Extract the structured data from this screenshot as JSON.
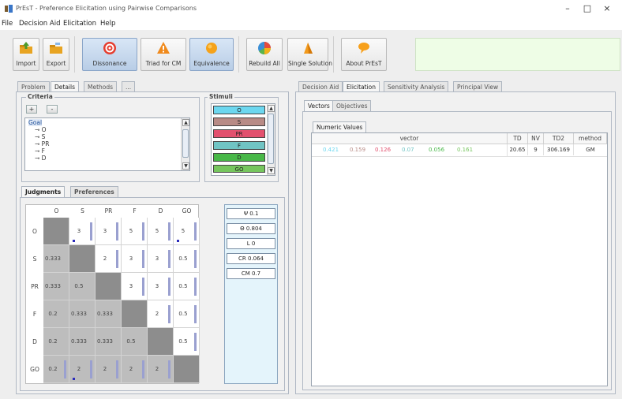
{
  "window": {
    "title": "PrEsT - Preference Elicitation using Pairwise Comparisons",
    "minimize": "–",
    "maximize": "□",
    "close": "×"
  },
  "menu": [
    "File",
    "Decision Aid",
    "Elicitation",
    "Help"
  ],
  "toolbar": {
    "buttons": [
      {
        "label": "Import",
        "icon": "folder-up-icon"
      },
      {
        "label": "Export",
        "icon": "folder-export-icon"
      },
      {
        "label": "Dissonance",
        "icon": "target-icon"
      },
      {
        "label": "Triad for CM",
        "icon": "warning-triangle-icon"
      },
      {
        "label": "Equivalence",
        "icon": "orange-circle-icon"
      },
      {
        "label": "Rebuild All",
        "icon": "pie-chart-icon"
      },
      {
        "label": "Single Solution",
        "icon": "cone-icon"
      },
      {
        "label": "About PrEsT",
        "icon": "speech-bubble-icon"
      }
    ]
  },
  "left_tabs": [
    "Problem",
    "Details",
    "Methods",
    "..."
  ],
  "criteria": {
    "title": "Criteria",
    "add": "+",
    "remove": "-",
    "tree": [
      "Goal",
      "O",
      "S",
      "PR",
      "F",
      "D"
    ]
  },
  "stimuli": {
    "title": "Stimuli",
    "items": [
      {
        "label": "O",
        "color": "#6cd7ef"
      },
      {
        "label": "S",
        "color": "#b88b86"
      },
      {
        "label": "PR",
        "color": "#e2506e"
      },
      {
        "label": "F",
        "color": "#70c4c4"
      },
      {
        "label": "D",
        "color": "#48b848"
      },
      {
        "label": "GO",
        "color": "#76c65e"
      }
    ]
  },
  "matrix_tabs": [
    "Judgments",
    "Preferences"
  ],
  "matrix": {
    "labels": [
      "O",
      "S",
      "PR",
      "F",
      "D",
      "GO"
    ],
    "rows": [
      [
        "",
        "3",
        "3",
        "5",
        "5",
        "5"
      ],
      [
        "0.333",
        "",
        "2",
        "3",
        "3",
        "0.5"
      ],
      [
        "0.333",
        "0.5",
        "",
        "3",
        "3",
        "0.5"
      ],
      [
        "0.2",
        "0.333",
        "0.333",
        "",
        "2",
        "0.5"
      ],
      [
        "0.2",
        "0.333",
        "0.333",
        "0.5",
        "",
        "0.5"
      ],
      [
        "0.2",
        "2",
        "2",
        "2",
        "2",
        ""
      ]
    ]
  },
  "stats": [
    "Ψ  0.1",
    "Θ  0.804",
    "L  0",
    "CR  0.064",
    "CM  0.7"
  ],
  "right_tabs": [
    "Decision Aid",
    "Elicitation",
    "Sensitivity Analysis",
    "Principal View"
  ],
  "inner_tabs": [
    "Vectors",
    "Objectives"
  ],
  "numeric_tab": "Numeric Values",
  "table": {
    "headers": [
      "vector",
      "TD",
      "NV",
      "TD2",
      "method"
    ],
    "row": {
      "vector": [
        {
          "v": "0.421",
          "color": "#6cd7ef"
        },
        {
          "v": "0.159",
          "color": "#b88b86"
        },
        {
          "v": "0.126",
          "color": "#e2506e"
        },
        {
          "v": "0.07",
          "color": "#70c4c4"
        },
        {
          "v": "0.056",
          "color": "#48b848"
        },
        {
          "v": "0.161",
          "color": "#76c65e"
        }
      ],
      "TD": "20.65",
      "NV": "9",
      "TD2": "306.169",
      "method": "GM"
    }
  }
}
